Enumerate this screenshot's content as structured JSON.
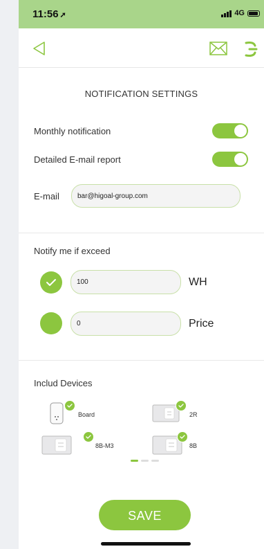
{
  "status_bar": {
    "time": "11:56",
    "network": "4G"
  },
  "header": {
    "back_icon": "back-triangle-icon",
    "mail_icon": "mail-icon",
    "menu_icon": "menu-icon"
  },
  "title": "NOTIFICATION SETTINGS",
  "settings": {
    "monthly_label": "Monthly notification",
    "monthly_on": true,
    "detailed_label": "Detailed E-mail report",
    "detailed_on": true,
    "email_label": "E-mail",
    "email_value": "bar@higoal-group.com"
  },
  "notify": {
    "heading": "Notify me if exceed",
    "wh_value": "100",
    "wh_unit": "WH",
    "wh_checked": true,
    "price_value": "0",
    "price_unit": "Price",
    "price_checked": false
  },
  "devices": {
    "heading": "Includ Devices",
    "items": [
      {
        "name": "Board",
        "checked": true
      },
      {
        "name": "2R",
        "checked": true
      },
      {
        "name": "8B-M3",
        "checked": true
      },
      {
        "name": "8B",
        "checked": true
      }
    ],
    "page_dots": 3,
    "active_dot": 0
  },
  "save_label": "SAVE",
  "colors": {
    "accent": "#8cc63f",
    "status_bar": "#a9d58a"
  }
}
